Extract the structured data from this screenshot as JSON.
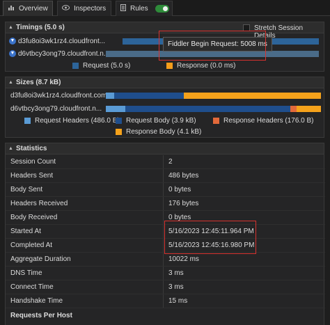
{
  "tabs": [
    {
      "label": "Overview",
      "icon": "chart-icon"
    },
    {
      "label": "Inspectors",
      "icon": "eye-icon"
    },
    {
      "label": "Rules",
      "icon": "rules-icon",
      "toggle_on": true
    }
  ],
  "timings": {
    "title": "Timings (5.0 s)",
    "stretch_label": "Stretch Session Details",
    "rows": [
      {
        "host": "d3fu8oi3wk1rz4.cloudfront...",
        "request_fraction": 1.0
      },
      {
        "host": "d6vtbcy3ong79.cloudfront.n...",
        "request_fraction": 0.0
      }
    ],
    "tooltip": "Fiddler Begin Request: 5008 ms",
    "legend": [
      {
        "label": "Request (5.0 s)",
        "color": "#2d6499"
      },
      {
        "label": "Response (0.0 ms)",
        "color": "#f59d1b"
      }
    ]
  },
  "sizes": {
    "title": "Sizes (8.7 kB)",
    "rows": [
      {
        "host": "d3fu8oi3wk1rz4.cloudfront.com..."
      },
      {
        "host": "d6vtbcy3ong79.cloudfront.n..."
      }
    ],
    "legend": [
      {
        "label": "Request Headers (486.0 B)",
        "color": "#5a9bd5"
      },
      {
        "label": "Request Body (3.9 kB)",
        "color": "#1f4e8c"
      },
      {
        "label": "Response Headers (176.0 B)",
        "color": "#e2693a"
      },
      {
        "label": "Response Body (4.1 kB)",
        "color": "#f5a21b"
      }
    ]
  },
  "statistics": {
    "title": "Statistics",
    "rows": [
      {
        "label": "Session Count",
        "value": "2"
      },
      {
        "label": "Headers Sent",
        "value": "486 bytes"
      },
      {
        "label": "Body Sent",
        "value": "0 bytes"
      },
      {
        "label": "Headers Received",
        "value": "176 bytes"
      },
      {
        "label": "Body Received",
        "value": "0 bytes"
      },
      {
        "label": "Started At",
        "value": "5/16/2023 12:45:11.964 PM"
      },
      {
        "label": "Completed At",
        "value": "5/16/2023 12:45:16.980 PM"
      },
      {
        "label": "Aggregate Duration",
        "value": "10022 ms"
      },
      {
        "label": "DNS Time",
        "value": "3 ms"
      },
      {
        "label": "Connect Time",
        "value": "3 ms"
      },
      {
        "label": "Handshake Time",
        "value": "15 ms"
      }
    ],
    "footer": "Requests Per Host"
  }
}
